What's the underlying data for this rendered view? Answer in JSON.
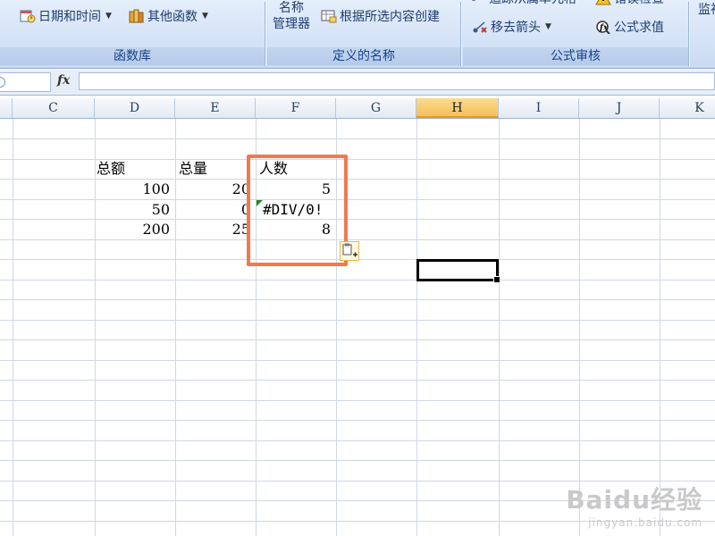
{
  "ribbon": {
    "groups": {
      "function_library": {
        "label": "函数库",
        "date_time": "日期和时间",
        "other_functions": "其他函数"
      },
      "defined_names": {
        "label": "定义的名称",
        "name_manager_line1": "名称",
        "name_manager_line2": "管理器",
        "create_from_selection": "根据所选内容创建"
      },
      "formula_auditing": {
        "label": "公式审核",
        "trace_dependents": "追踪从属单元格",
        "error_checking": "错误检查",
        "remove_arrows": "移去箭头",
        "evaluate_formula": "公式求值"
      },
      "watch": {
        "label": "监视"
      }
    }
  },
  "formula_bar": {
    "fx": "fx",
    "name_box": "",
    "formula": ""
  },
  "columns": [
    "C",
    "D",
    "E",
    "F",
    "G",
    "H",
    "I",
    "J",
    "K"
  ],
  "selected_column": "H",
  "cells": {
    "d_header": "总额",
    "e_header": "总量",
    "f_header": "人数",
    "d1": "100",
    "e1": "20",
    "f1": "5",
    "d2": "50",
    "e2": "0",
    "f2": "#DIV/0!",
    "d3": "200",
    "e3": "25",
    "f3": "8"
  },
  "watermark": {
    "line1": "Baidu经验",
    "line2": "jingyan.baidu.com"
  },
  "colors": {
    "highlight": "#f07a50",
    "selected_header": "#f5c05a",
    "ribbon_text": "#15428b"
  }
}
